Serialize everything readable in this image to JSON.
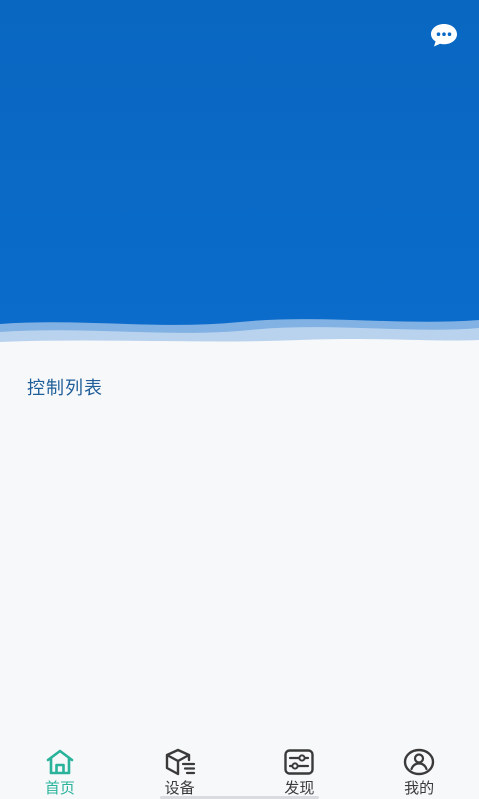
{
  "header": {
    "message_icon": "chat-bubble-icon",
    "banner_color": "#0a69c4"
  },
  "main": {
    "section_title": "控制列表"
  },
  "tabbar": {
    "active_color": "#29b39a",
    "items": [
      {
        "label": "首页",
        "icon": "home-icon",
        "active": true
      },
      {
        "label": "设备",
        "icon": "device-box-icon",
        "active": false
      },
      {
        "label": "发现",
        "icon": "discover-sliders-icon",
        "active": false
      },
      {
        "label": "我的",
        "icon": "user-profile-icon",
        "active": false
      }
    ]
  }
}
